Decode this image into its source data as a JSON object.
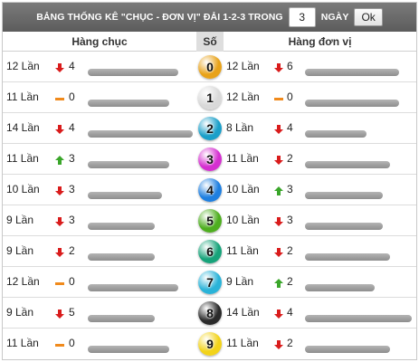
{
  "header": {
    "title": "BẢNG THỐNG KÊ \"CHỤC - ĐƠN VỊ\" ĐẢI 1-2-3 TRONG",
    "days_value": "3",
    "days_label": "NGÀY",
    "ok_label": "Ok"
  },
  "columns": {
    "tens": "Hàng chục",
    "number": "Số",
    "units": "Hàng đơn vị"
  },
  "colors": {
    "down": "#d91c1c",
    "up": "#3aa62a",
    "same": "#f08a1c"
  },
  "rows": [
    {
      "num": "0",
      "ball_color": "#e8a219",
      "tens": {
        "count": "12 Lần",
        "dir": "down",
        "delta": "4",
        "bar_fraction": 0.86
      },
      "units": {
        "count": "12 Lần",
        "dir": "down",
        "delta": "6",
        "bar_fraction": 0.88
      }
    },
    {
      "num": "1",
      "ball_color": "#d9d9d9",
      "tens": {
        "count": "11 Lần",
        "dir": "same",
        "delta": "0",
        "bar_fraction": 0.78
      },
      "units": {
        "count": "12 Lần",
        "dir": "same",
        "delta": "0",
        "bar_fraction": 0.88
      }
    },
    {
      "num": "2",
      "ball_color": "#1a9fc9",
      "tens": {
        "count": "14 Lần",
        "dir": "down",
        "delta": "4",
        "bar_fraction": 1.0
      },
      "units": {
        "count": "8 Lần",
        "dir": "down",
        "delta": "4",
        "bar_fraction": 0.58
      }
    },
    {
      "num": "3",
      "ball_color": "#d52fd0",
      "tens": {
        "count": "11 Lần",
        "dir": "up",
        "delta": "3",
        "bar_fraction": 0.78
      },
      "units": {
        "count": "11 Lần",
        "dir": "down",
        "delta": "2",
        "bar_fraction": 0.8
      }
    },
    {
      "num": "4",
      "ball_color": "#1e7fe0",
      "tens": {
        "count": "10 Lần",
        "dir": "down",
        "delta": "3",
        "bar_fraction": 0.71
      },
      "units": {
        "count": "10 Lần",
        "dir": "up",
        "delta": "3",
        "bar_fraction": 0.73
      }
    },
    {
      "num": "5",
      "ball_color": "#4eae1f",
      "tens": {
        "count": "9 Lần",
        "dir": "down",
        "delta": "3",
        "bar_fraction": 0.64
      },
      "units": {
        "count": "10 Lần",
        "dir": "down",
        "delta": "3",
        "bar_fraction": 0.73
      }
    },
    {
      "num": "6",
      "ball_color": "#17a37a",
      "tens": {
        "count": "9 Lần",
        "dir": "down",
        "delta": "2",
        "bar_fraction": 0.64
      },
      "units": {
        "count": "11 Lần",
        "dir": "down",
        "delta": "2",
        "bar_fraction": 0.8
      }
    },
    {
      "num": "7",
      "ball_color": "#2ab3d8",
      "tens": {
        "count": "12 Lần",
        "dir": "same",
        "delta": "0",
        "bar_fraction": 0.86
      },
      "units": {
        "count": "9 Lần",
        "dir": "up",
        "delta": "2",
        "bar_fraction": 0.65
      }
    },
    {
      "num": "8",
      "ball_color": "#2a2a2a",
      "tens": {
        "count": "9 Lần",
        "dir": "down",
        "delta": "5",
        "bar_fraction": 0.64
      },
      "units": {
        "count": "14 Lần",
        "dir": "down",
        "delta": "4",
        "bar_fraction": 1.0
      }
    },
    {
      "num": "9",
      "ball_color": "#f2d31a",
      "tens": {
        "count": "11 Lần",
        "dir": "same",
        "delta": "0",
        "bar_fraction": 0.78
      },
      "units": {
        "count": "11 Lần",
        "dir": "down",
        "delta": "2",
        "bar_fraction": 0.8
      }
    }
  ]
}
